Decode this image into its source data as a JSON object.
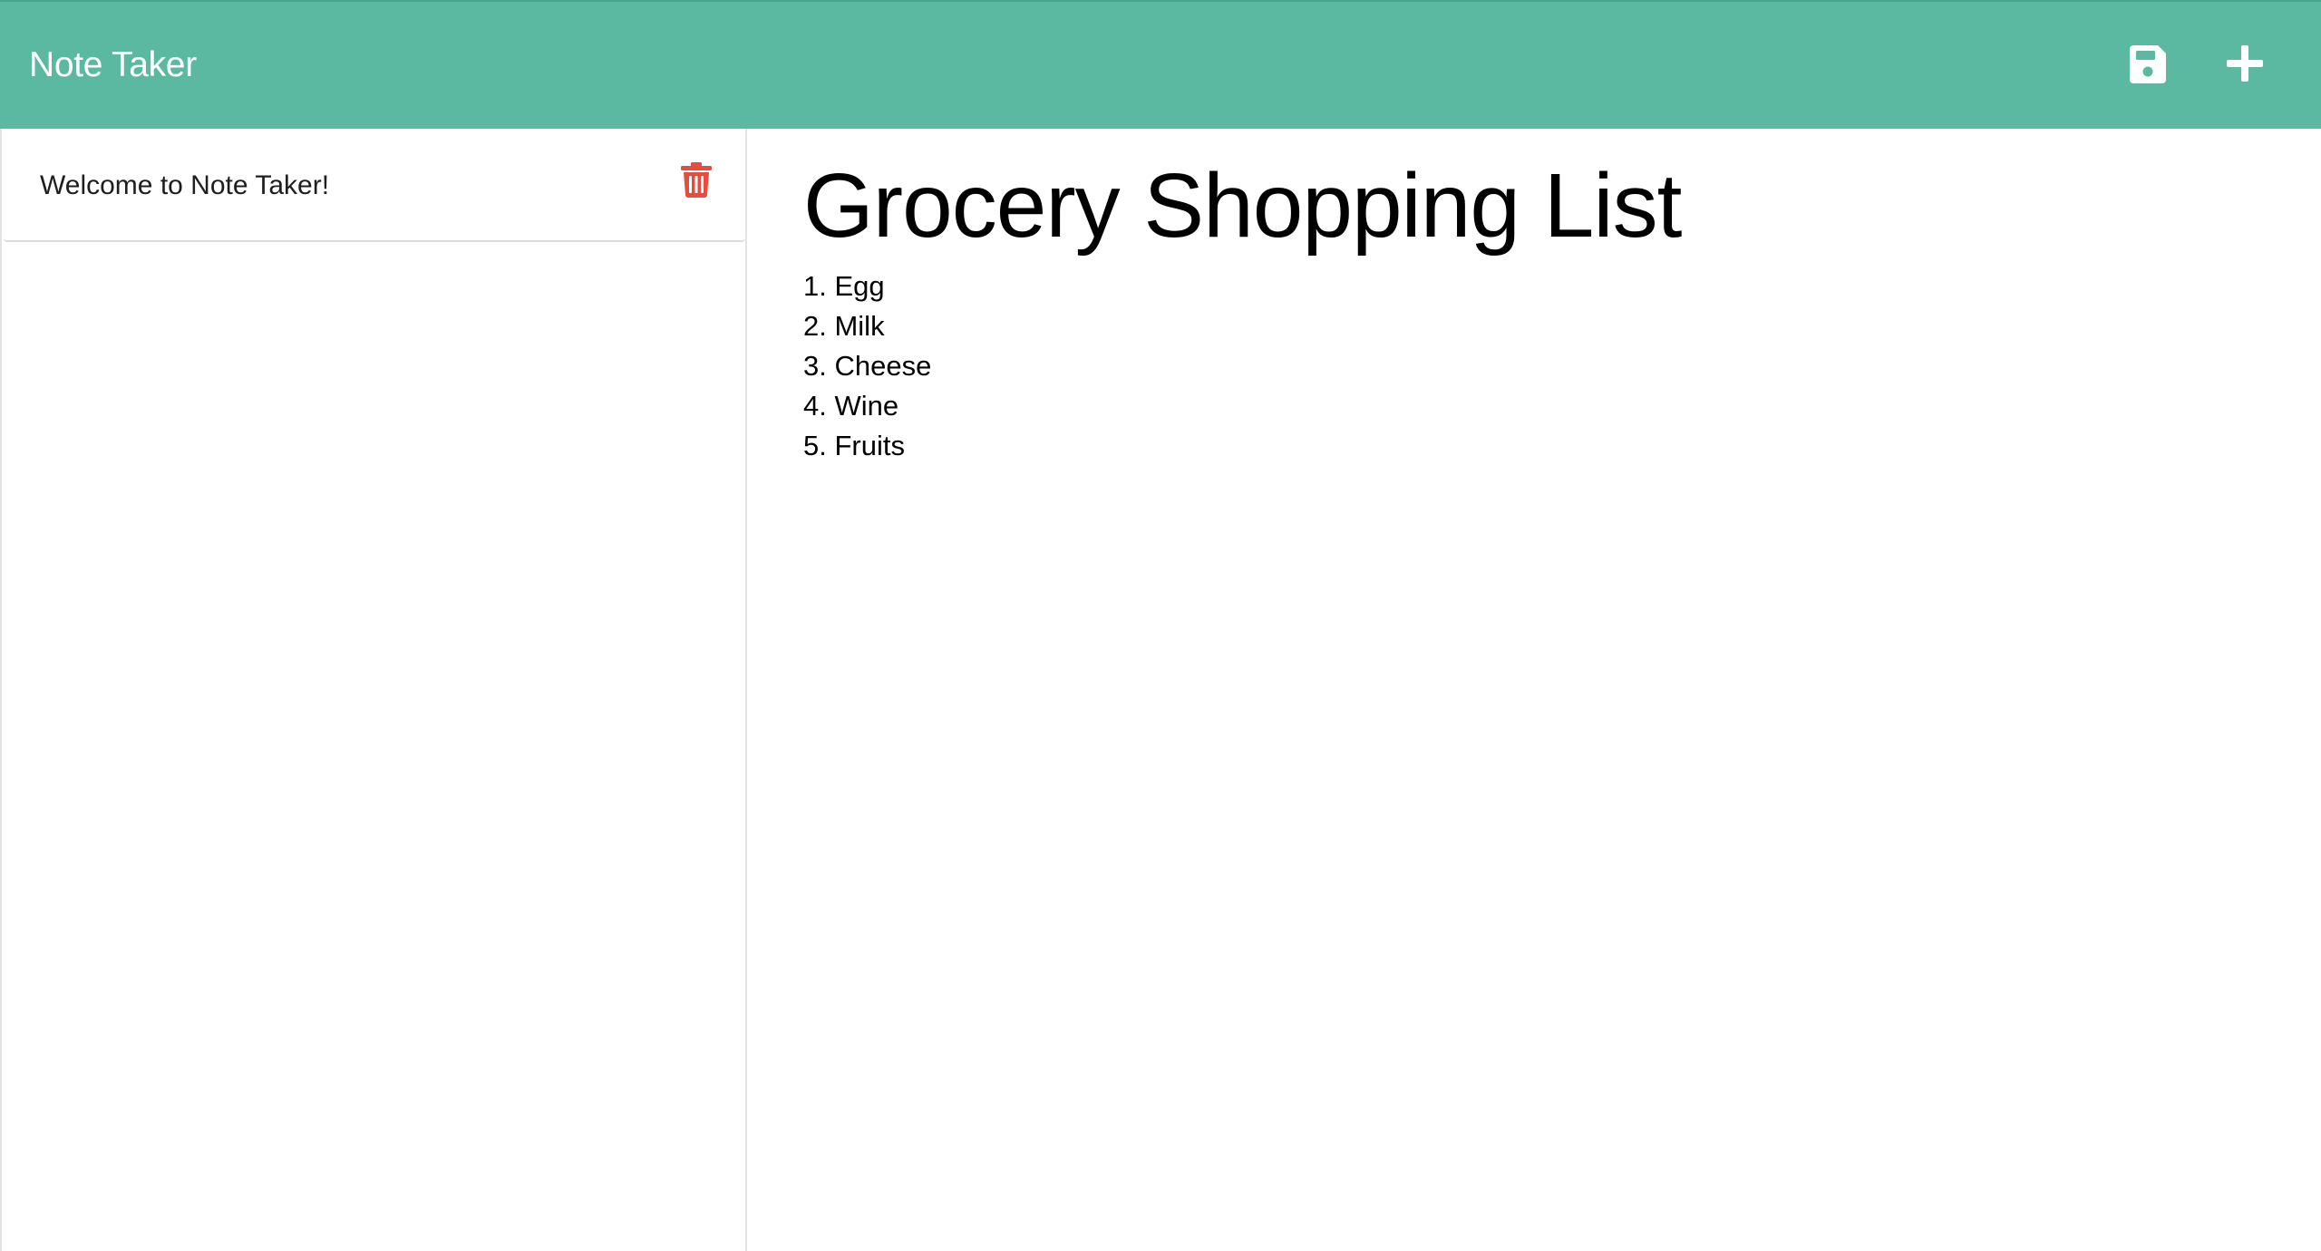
{
  "navbar": {
    "brand": "Note Taker",
    "save_icon": "floppy-disk-icon",
    "new_icon": "plus-icon",
    "color": "#5ab9a0"
  },
  "sidebar": {
    "notes": [
      {
        "title": "Welcome to Note Taker!",
        "delete_icon": "trash-icon",
        "delete_color": "#e74c3c"
      }
    ]
  },
  "editor": {
    "title": "Grocery Shopping List",
    "body": "1. Egg\n2. Milk\n3. Cheese\n4. Wine\n5. Fruits"
  }
}
